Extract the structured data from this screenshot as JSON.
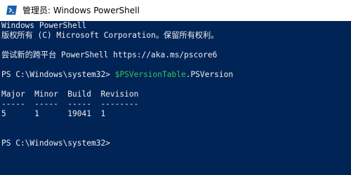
{
  "window": {
    "title": "管理员: Windows PowerShell",
    "icon": "powershell-icon"
  },
  "console": {
    "banner_line1": "Windows PowerShell",
    "banner_line2": "版权所有 (C) Microsoft Corporation。保留所有权利。",
    "banner_line3": "尝试新的跨平台 PowerShell https://aka.ms/pscore6",
    "prompt1": "PS C:\\Windows\\system32> ",
    "command_var": "$PSVersionTable",
    "command_prop": ".PSVersion",
    "table_header": "Major  Minor  Build  Revision",
    "table_rule": "-----  -----  -----  --------",
    "table_row": "5      1      19041  1",
    "prompt2": "PS C:\\Windows\\system32>"
  },
  "colors": {
    "console_bg": "#012456",
    "console_fg": "#EEEDF0",
    "command_highlight": "#37C35A"
  }
}
